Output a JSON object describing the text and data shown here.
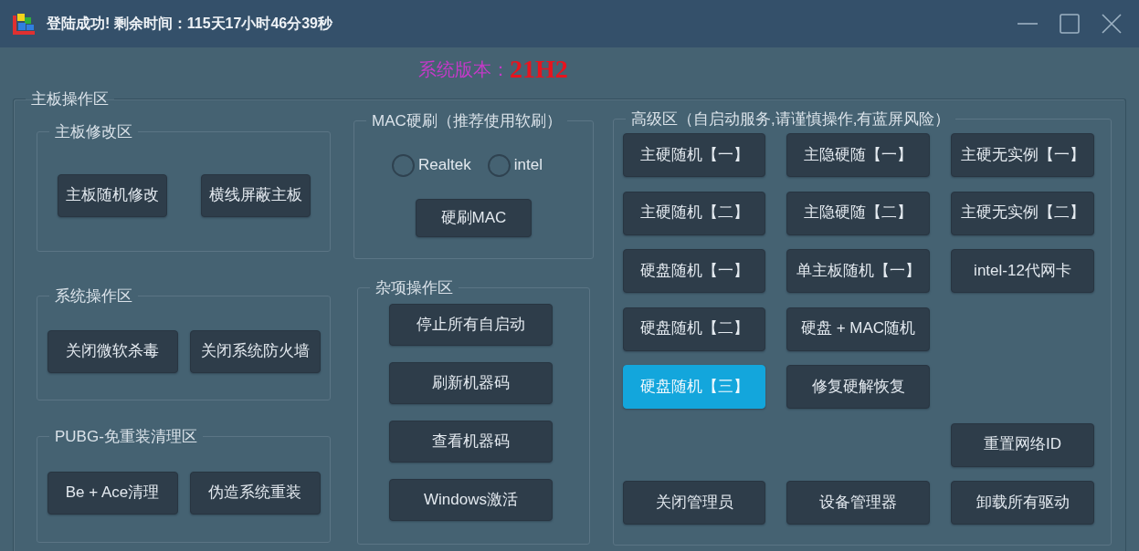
{
  "window": {
    "title": "登陆成功! 剩余时间：115天17小时46分39秒"
  },
  "version": {
    "label": "系统版本：",
    "value": "21H2"
  },
  "main_group": {
    "title": "主板操作区",
    "left_sections": [
      {
        "title": "主板修改区",
        "buttons": [
          "主板随机修改",
          "横线屏蔽主板"
        ]
      },
      {
        "title": "系统操作区",
        "buttons": [
          "关闭微软杀毒",
          "关闭系统防火墙"
        ]
      },
      {
        "title": "PUBG-免重装清理区",
        "buttons": [
          "Be + Ace清理",
          "伪造系统重装"
        ]
      }
    ],
    "mac_section": {
      "title": "MAC硬刷（推荐使用软刷）",
      "options": [
        {
          "label": "Realtek",
          "checked": false
        },
        {
          "label": "intel",
          "checked": false
        }
      ],
      "button": "硬刷MAC"
    },
    "misc_section": {
      "title": "杂项操作区",
      "buttons": [
        "停止所有自启动",
        "刷新机器码",
        "查看机器码",
        "Windows激活"
      ]
    },
    "advanced_section": {
      "title": "高级区（自启动服务,请谨慎操作,有蓝屏风险）",
      "rows": [
        [
          {
            "kind": "button",
            "label": "主硬随机【一】",
            "selected": false
          },
          {
            "kind": "button",
            "label": "主隐硬随【一】",
            "selected": false
          },
          {
            "kind": "button",
            "label": "主硬无实例【一】",
            "selected": false
          }
        ],
        [
          {
            "kind": "button",
            "label": "主硬随机【二】",
            "selected": false
          },
          {
            "kind": "button",
            "label": "主隐硬随【二】",
            "selected": false
          },
          {
            "kind": "button",
            "label": "主硬无实例【二】",
            "selected": false
          }
        ],
        [
          {
            "kind": "button",
            "label": "硬盘随机【一】",
            "selected": false
          },
          {
            "kind": "button",
            "label": "单主板随机【一】",
            "selected": false
          },
          {
            "kind": "button",
            "label": "intel-12代网卡",
            "selected": false
          }
        ],
        [
          {
            "kind": "button",
            "label": "硬盘随机【二】",
            "selected": false
          },
          {
            "kind": "button",
            "label": "硬盘 + MAC随机",
            "selected": false
          },
          {
            "kind": "empty"
          }
        ],
        [
          {
            "kind": "button",
            "label": "硬盘随机【三】",
            "selected": true
          },
          {
            "kind": "button",
            "label": "修复硬解恢复",
            "selected": false
          },
          {
            "kind": "empty"
          }
        ],
        [
          {
            "kind": "empty"
          },
          {
            "kind": "empty"
          },
          {
            "kind": "button",
            "label": "重置网络ID",
            "selected": false
          }
        ],
        [
          {
            "kind": "button",
            "label": "关闭管理员",
            "selected": false
          },
          {
            "kind": "button",
            "label": "设备管理器",
            "selected": false
          },
          {
            "kind": "button",
            "label": "卸载所有驱动",
            "selected": false
          }
        ]
      ]
    }
  }
}
